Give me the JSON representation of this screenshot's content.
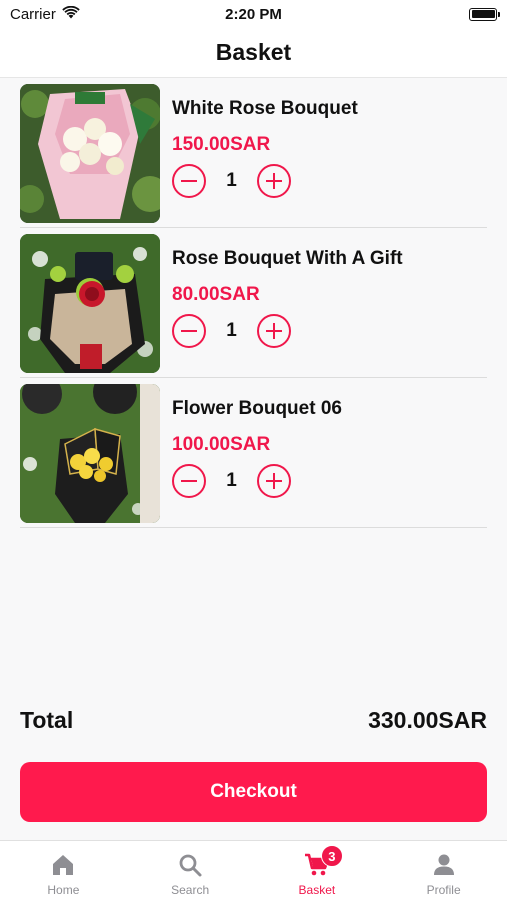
{
  "status_bar": {
    "carrier": "Carrier",
    "time": "2:20 PM"
  },
  "header": {
    "title": "Basket"
  },
  "items": [
    {
      "name": "White Rose Bouquet",
      "price": "150.00SAR",
      "quantity": "1"
    },
    {
      "name": "Rose Bouquet With A Gift",
      "price": "80.00SAR",
      "quantity": "1"
    },
    {
      "name": "Flower Bouquet 06",
      "price": "100.00SAR",
      "quantity": "1"
    }
  ],
  "summary": {
    "total_label": "Total",
    "total_value": "330.00SAR"
  },
  "checkout": {
    "label": "Checkout"
  },
  "tab_bar": {
    "tabs": [
      {
        "label": "Home",
        "icon": "home-icon"
      },
      {
        "label": "Search",
        "icon": "search-icon"
      },
      {
        "label": "Basket",
        "icon": "cart-icon",
        "badge": "3"
      },
      {
        "label": "Profile",
        "icon": "person-icon"
      }
    ],
    "active_index": 2
  },
  "colors": {
    "accent": "#f0174b",
    "checkout_bg": "#ff1a4d",
    "inactive_tab": "#8e8e93"
  }
}
